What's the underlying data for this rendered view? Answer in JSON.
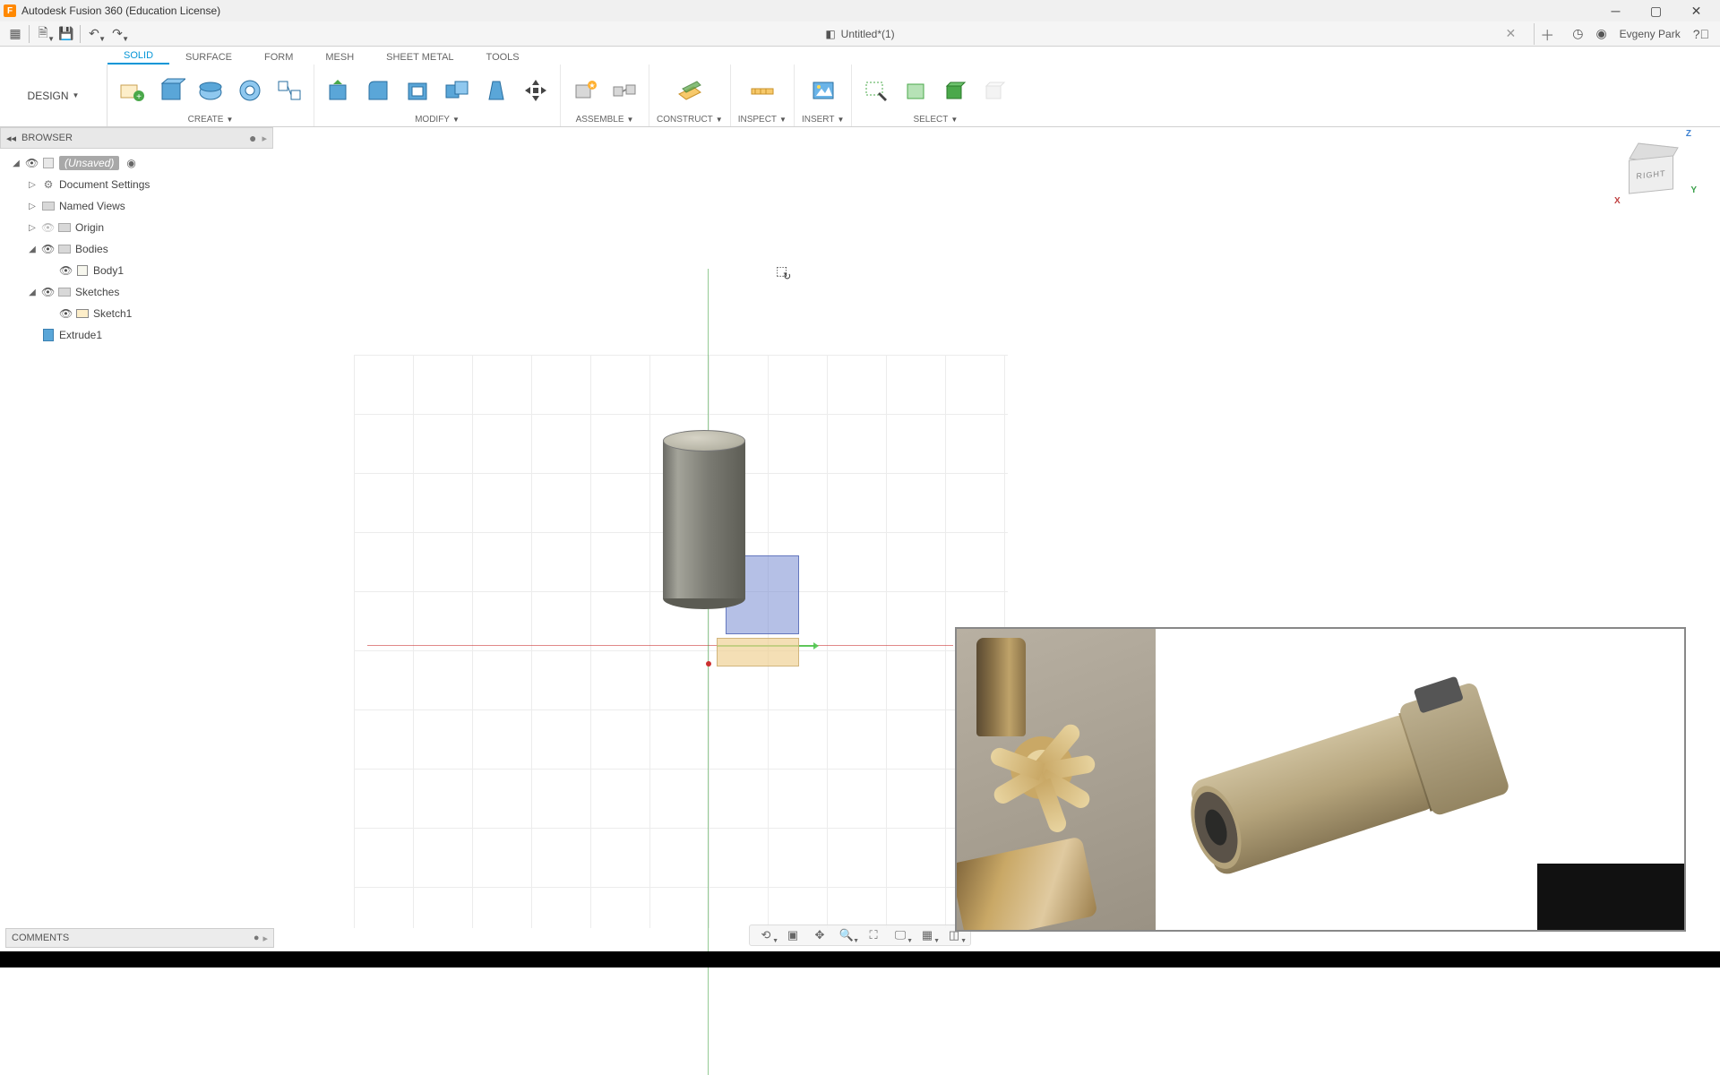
{
  "titlebar": {
    "app_title": "Autodesk Fusion 360 (Education License)"
  },
  "quickbar": {
    "document_title": "Untitled*(1)",
    "user_name": "Evgeny Park"
  },
  "workspace": {
    "label": "DESIGN"
  },
  "ribbon_tabs": {
    "solid": "SOLID",
    "surface": "SURFACE",
    "form": "FORM",
    "mesh": "MESH",
    "sheet_metal": "SHEET METAL",
    "tools": "TOOLS"
  },
  "ribbon_groups": {
    "create": "CREATE",
    "modify": "MODIFY",
    "assemble": "ASSEMBLE",
    "construct": "CONSTRUCT",
    "inspect": "INSPECT",
    "insert": "INSERT",
    "select": "SELECT"
  },
  "browser": {
    "title": "BROWSER",
    "root": "(Unsaved)",
    "doc_settings": "Document Settings",
    "named_views": "Named Views",
    "origin": "Origin",
    "bodies": "Bodies",
    "body1": "Body1",
    "sketches": "Sketches",
    "sketch1": "Sketch1",
    "extrude1": "Extrude1"
  },
  "comments": {
    "title": "COMMENTS"
  },
  "viewcube": {
    "face": "RIGHT",
    "z": "Z",
    "y": "Y",
    "x": "X"
  }
}
